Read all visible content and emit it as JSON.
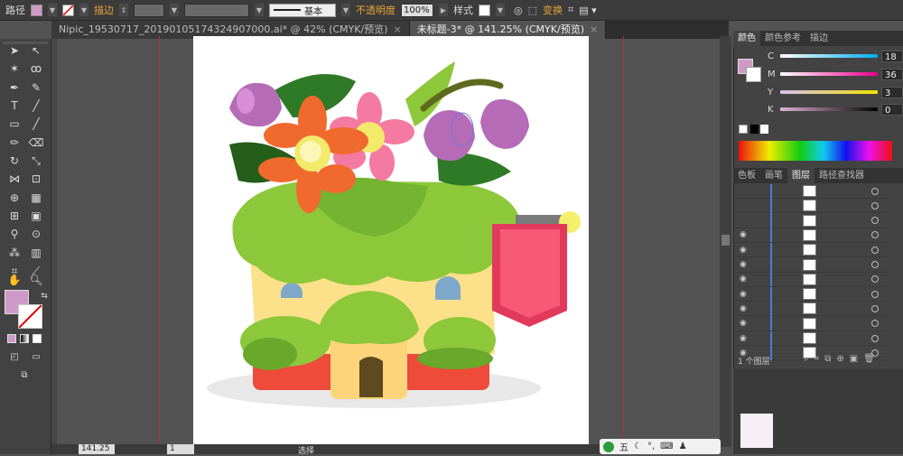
{
  "control_bar": {
    "path_label": "路径",
    "stroke_label": "描边",
    "stroke_style": "基本",
    "opacity_label": "不透明度",
    "opacity_value": "100%",
    "style_label": "样式",
    "transform_label": "变换"
  },
  "doc_tabs": [
    {
      "label": "Nipic_19530717_20190105174324907000.ai* @ 42% (CMYK/预览)",
      "close": "×"
    },
    {
      "label": "未标题-3* @ 141.25% (CMYK/预览)",
      "close": "×"
    }
  ],
  "color_panel": {
    "tabs": [
      "颜色",
      "颜色参考",
      "描边"
    ],
    "c_label": "C",
    "c_value": "18",
    "m_label": "M",
    "m_value": "36",
    "y_label": "Y",
    "y_value": "3",
    "k_label": "K",
    "k_value": "0",
    "fill_color": "#d09ac8"
  },
  "layers_panel": {
    "tabs": [
      "色板",
      "画笔",
      "图层",
      "路径查找器"
    ],
    "footer": "1 个图层"
  },
  "status_bar": {
    "zoom": "141.25",
    "page": "1",
    "tool": "选择"
  },
  "ime": {
    "label": "五"
  },
  "colors": {
    "accent": "#e8a23a",
    "guide": "#aa3333",
    "selected": "#4b7bd8"
  }
}
